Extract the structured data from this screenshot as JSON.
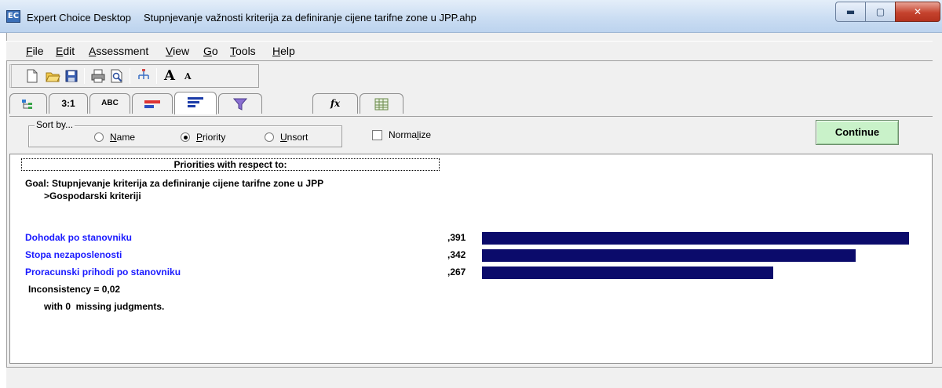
{
  "window": {
    "app_name": "Expert Choice Desktop",
    "document_title": "Stupnjevanje važnosti kriterija za definiranje cijene tarifne zone u JPP.ahp",
    "app_icon_glyph": "EC",
    "minimize_glyph": "▬",
    "maximize_glyph": "▢",
    "close_glyph": "✕"
  },
  "menu": {
    "items": [
      {
        "u": "F",
        "rest": "ile"
      },
      {
        "u": "E",
        "rest": "dit"
      },
      {
        "u": "A",
        "rest": "ssessment"
      },
      {
        "u": "V",
        "rest": "iew"
      },
      {
        "u": "G",
        "rest": "o"
      },
      {
        "u": "T",
        "rest": "ools"
      },
      {
        "u": "H",
        "rest": "elp"
      }
    ]
  },
  "toolbar": {
    "icons": [
      "new-file-icon",
      "open-folder-icon",
      "save-icon",
      "print-icon",
      "print-preview-icon",
      "tree-split-icon",
      "font-larger-icon",
      "font-smaller-icon"
    ],
    "font_larger_glyph": "A",
    "font_smaller_glyph": "A"
  },
  "tabs": [
    {
      "icon": "tree-view-icon",
      "label": ""
    },
    {
      "icon": "",
      "label": "3:1"
    },
    {
      "icon": "",
      "label": "ABC"
    },
    {
      "icon": "graphical-icon",
      "label": ""
    },
    {
      "icon": "priorities-bar-icon",
      "label": ""
    },
    {
      "icon": "funnel-icon",
      "label": ""
    },
    {
      "icon": "formula-icon",
      "label": "fx"
    },
    {
      "icon": "grid-icon",
      "label": ""
    }
  ],
  "options": {
    "sort_legend": "Sort by...",
    "radios": [
      {
        "u": "N",
        "rest": "ame",
        "checked": false
      },
      {
        "u": "P",
        "rest": "riority",
        "checked": true
      },
      {
        "u": "U",
        "rest": "nsort",
        "checked": false
      }
    ],
    "normalize_pre": "Norma",
    "normalize_u": "l",
    "normalize_post": "ize",
    "continue_label": "Continue"
  },
  "priorities": {
    "header": "Priorities with respect to:",
    "goal": "Goal: Stupnjevanje kriterija za definiranje cijene tarifne zone u JPP",
    "sub_node": ">Gospodarski kriteriji",
    "inconsistency": "Inconsistency = 0,02",
    "missing": "with 0  missing judgments."
  },
  "colors": {
    "criteria_text": "#1a1aff",
    "bar": "#0b0b6b",
    "continue_bg": "#c9f2c9"
  },
  "chart_data": {
    "type": "bar",
    "categories": [
      "Dohodak po stanovniku",
      "Stopa nezaposlenosti",
      "Proracunski prihodi po stanovniku"
    ],
    "values": [
      0.391,
      0.342,
      0.267
    ],
    "value_labels": [
      ",391",
      ",342",
      ",267"
    ]
  }
}
